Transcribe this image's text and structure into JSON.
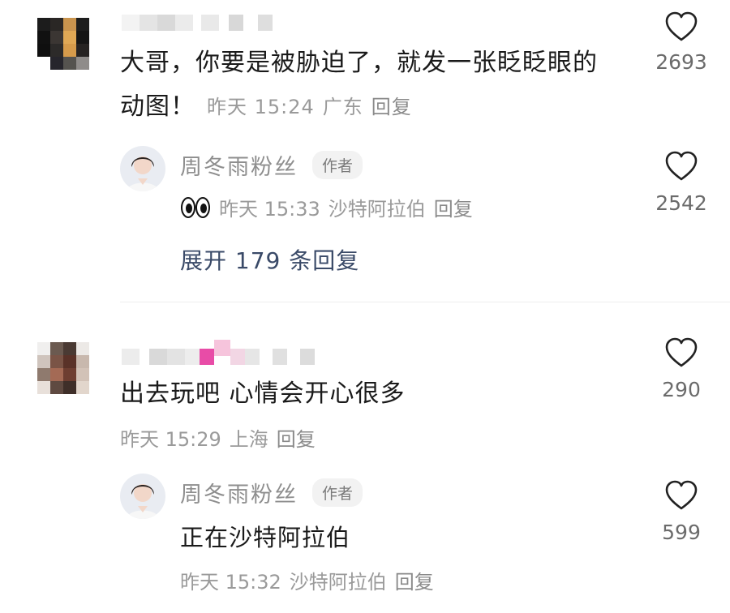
{
  "comments": [
    {
      "text_line1": "大哥，你要是被胁迫了，就发一张眨眨眼的",
      "text_line2": "动图！",
      "time": "昨天 15:24",
      "location": "广东",
      "reply_label": "回复",
      "likes": "2693",
      "reply": {
        "name": "周冬雨粉丝",
        "author_tag": "作者",
        "emoji": "eyes",
        "time": "昨天 15:33",
        "location": "沙特阿拉伯",
        "reply_label": "回复",
        "likes": "2542"
      },
      "expand_label": "展开 179 条回复"
    },
    {
      "text": "出去玩吧 心情会开心很多",
      "time": "昨天 15:29",
      "location": "上海",
      "reply_label": "回复",
      "likes": "290",
      "reply": {
        "name": "周冬雨粉丝",
        "author_tag": "作者",
        "text": "正在沙特阿拉伯",
        "time": "昨天 15:32",
        "location": "沙特阿拉伯",
        "reply_label": "回复",
        "likes": "599"
      }
    }
  ],
  "icons": {
    "like": "heart-outline-icon",
    "emoji": "eyes-emoji-icon"
  }
}
